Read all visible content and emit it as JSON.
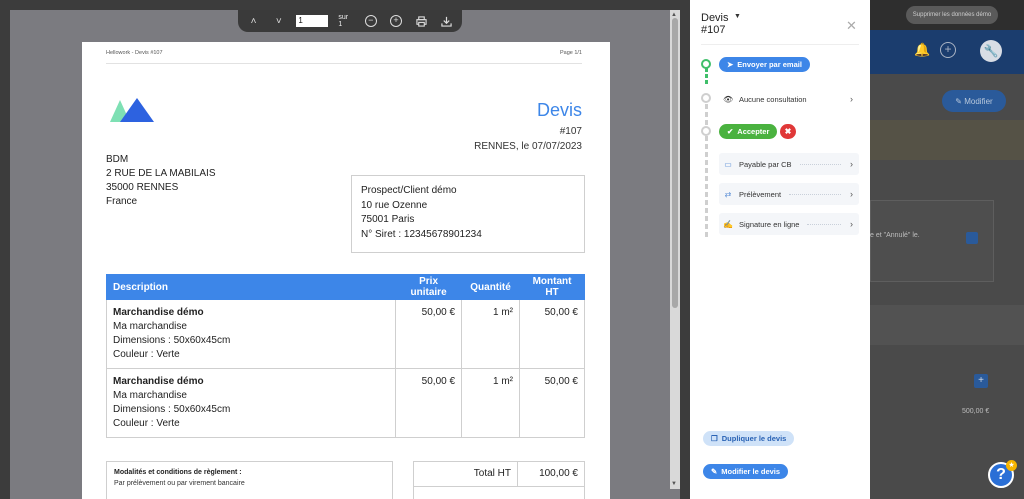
{
  "background": {
    "delete_button": "Supprimer les données démo",
    "modifier_button": "Modifier",
    "card_text": "e et \"Annulé\" le.",
    "amount": "500,00 €",
    "help_icon": "?"
  },
  "viewer": {
    "toolbar": {
      "page_current": "1",
      "page_of": "sur 1"
    }
  },
  "document": {
    "header_left": "Hellowork - Devis #107",
    "header_right": "Page 1/1",
    "title": "Devis",
    "number": "#107",
    "city_date": "RENNES, le 07/07/2023",
    "sender": [
      "BDM",
      "2 RUE DE LA MABILAIS",
      "35000 RENNES",
      "France"
    ],
    "client": [
      "Prospect/Client démo",
      "10 rue Ozenne",
      "75001 Paris",
      "N° Siret : 12345678901234"
    ],
    "table": {
      "headers": [
        "Description",
        "Prix unitaire",
        "Quantité",
        "Montant HT"
      ],
      "rows": [
        {
          "name": "Marchandise démo",
          "details": [
            "Ma marchandise",
            "Dimensions : 50x60x45cm",
            "Couleur : Verte"
          ],
          "unit_price": "50,00 €",
          "quantity": "1 m²",
          "amount": "50,00 €"
        },
        {
          "name": "Marchandise démo",
          "details": [
            "Ma marchandise",
            "Dimensions : 50x60x45cm",
            "Couleur : Verte"
          ],
          "unit_price": "50,00 €",
          "quantity": "1 m²",
          "amount": "50,00 €"
        }
      ]
    },
    "terms_title": "Modalités et conditions de règlement :",
    "terms_text": "Par prélèvement ou par virement bancaire",
    "total_ht_label": "Total HT",
    "total_ht_value": "100,00 €"
  },
  "panel": {
    "title_line1": "Devis",
    "title_line2": "#107",
    "send_email": "Envoyer par email",
    "consultation": "Aucune consultation",
    "accept": "Accepter",
    "options": [
      "Payable par CB",
      "Prélèvement",
      "Signature en ligne"
    ],
    "duplicate": "Dupliquer le devis",
    "edit": "Modifier le devis"
  },
  "colors": {
    "accent": "#3d86e8",
    "success": "#4ab23f",
    "danger": "#e03838"
  }
}
